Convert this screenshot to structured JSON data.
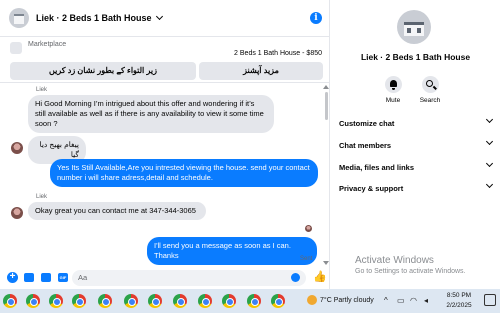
{
  "header": {
    "title": "Liek · 2 Beds 1 Bath House"
  },
  "marketplace": {
    "label": "Marketplace",
    "listing": "2 Beds 1 Bath House - $850",
    "buttons": [
      "زیر التواء کے بطور نشان زد کریں",
      "مزید آپشنز"
    ]
  },
  "messages": [
    {
      "sender": "Liek",
      "text": "Hi Good Morning I’m intrigued about this offer and wondering if it’s still available as well as if there is any availability to view it some time soon ?",
      "direction": "in"
    },
    {
      "text": "پیغام بھیج دیا گیا",
      "direction": "in"
    },
    {
      "text": "Yes Its Still Available,Are you intrested viewing the house. send your contact number i will share adress,detail and schedule.",
      "direction": "out"
    },
    {
      "sender": "Liek",
      "text": "Okay great you can contact me at 347-344-3065",
      "direction": "in"
    },
    {
      "text": "I'll send you a message as soon as I can. Thanks",
      "direction": "out",
      "status": "Sent"
    }
  ],
  "composer": {
    "placeholder": "Aa"
  },
  "info": {
    "title": "Liek · 2 Beds 1 Bath House",
    "actions": [
      "Mute",
      "Search"
    ],
    "sections": [
      "Customize chat",
      "Chat members",
      "Media, files and links",
      "Privacy & support"
    ]
  },
  "watermark": {
    "title": "Activate Windows",
    "subtitle": "Go to Settings to activate Windows."
  },
  "taskbar": {
    "weather": "7°C  Partly cloudy",
    "time": "8:50 PM",
    "date": "2/2/2025"
  },
  "colors": {
    "accent": "#0a7cff",
    "bubble_in": "#e4e6eb"
  },
  "icons": [
    "info-icon",
    "plus-icon",
    "image-icon",
    "gif-icon",
    "emoji-icon",
    "like-icon",
    "bell-icon",
    "search-icon",
    "chrome-icon",
    "weather-icon",
    "notification-icon"
  ]
}
